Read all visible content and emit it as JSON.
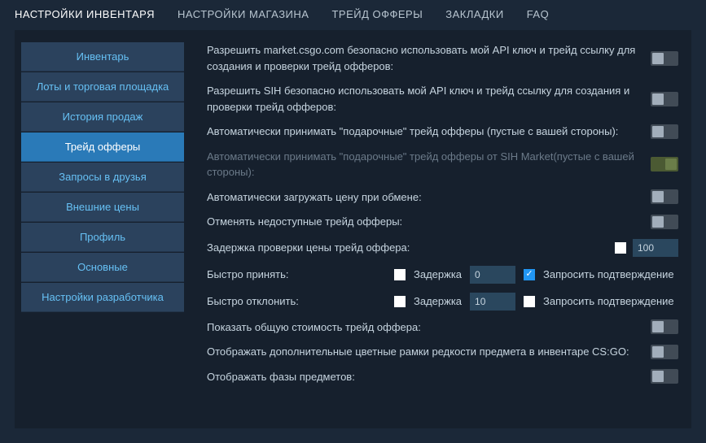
{
  "topnav": {
    "items": [
      "НАСТРОЙКИ ИНВЕНТАРЯ",
      "НАСТРОЙКИ МАГАЗИНА",
      "ТРЕЙД ОФФЕРЫ",
      "ЗАКЛАДКИ",
      "FAQ"
    ],
    "activeIndex": 0
  },
  "sidebar": {
    "items": [
      "Инвентарь",
      "Лоты и торговая площадка",
      "История продаж",
      "Трейд офферы",
      "Запросы в друзья",
      "Внешние цены",
      "Профиль",
      "Основные",
      "Настройки разработчика"
    ],
    "activeIndex": 3
  },
  "settings": {
    "allowMarketCsgo": {
      "label": "Разрешить market.csgo.com безопасно использовать мой API ключ и трейд ссылку для создания и проверки трейд офферов:",
      "value": false
    },
    "allowSIH": {
      "label": "Разрешить SIH безопасно использовать мой API ключ и трейд ссылку для создания и проверки трейд офферов:",
      "value": false
    },
    "autoAcceptGift": {
      "label": "Автоматически принимать \"подарочные\" трейд офферы (пустые с вашей стороны):",
      "value": false
    },
    "autoAcceptGiftSIH": {
      "label": "Автоматически принимать \"подарочные\" трейд офферы от SIH Market(пустые с вашей стороны):",
      "value": true,
      "disabled": true
    },
    "autoLoadPrice": {
      "label": "Автоматически загружать цену при обмене:",
      "value": false
    },
    "cancelUnavailable": {
      "label": "Отменять недоступные трейд офферы:",
      "value": false
    },
    "priceCheckDelay": {
      "label": "Задержка проверки цены трейд оффера:",
      "enabled": false,
      "value": "100"
    },
    "quickAccept": {
      "label": "Быстро принять:",
      "delayLabel": "Задержка",
      "delayEnabled": false,
      "delayValue": "0",
      "confirmLabel": "Запросить подтверждение",
      "confirmChecked": true
    },
    "quickDecline": {
      "label": "Быстро отклонить:",
      "delayLabel": "Задержка",
      "delayEnabled": false,
      "delayValue": "10",
      "confirmLabel": "Запросить подтверждение",
      "confirmChecked": false
    },
    "showTotalCost": {
      "label": "Показать общую стоимость трейд оффера:",
      "value": false
    },
    "showRarityFrames": {
      "label": "Отображать дополнительные цветные рамки редкости предмета в инвентаре CS:GO:",
      "value": false
    },
    "showPhases": {
      "label": "Отображать фазы предметов:",
      "value": false
    }
  }
}
